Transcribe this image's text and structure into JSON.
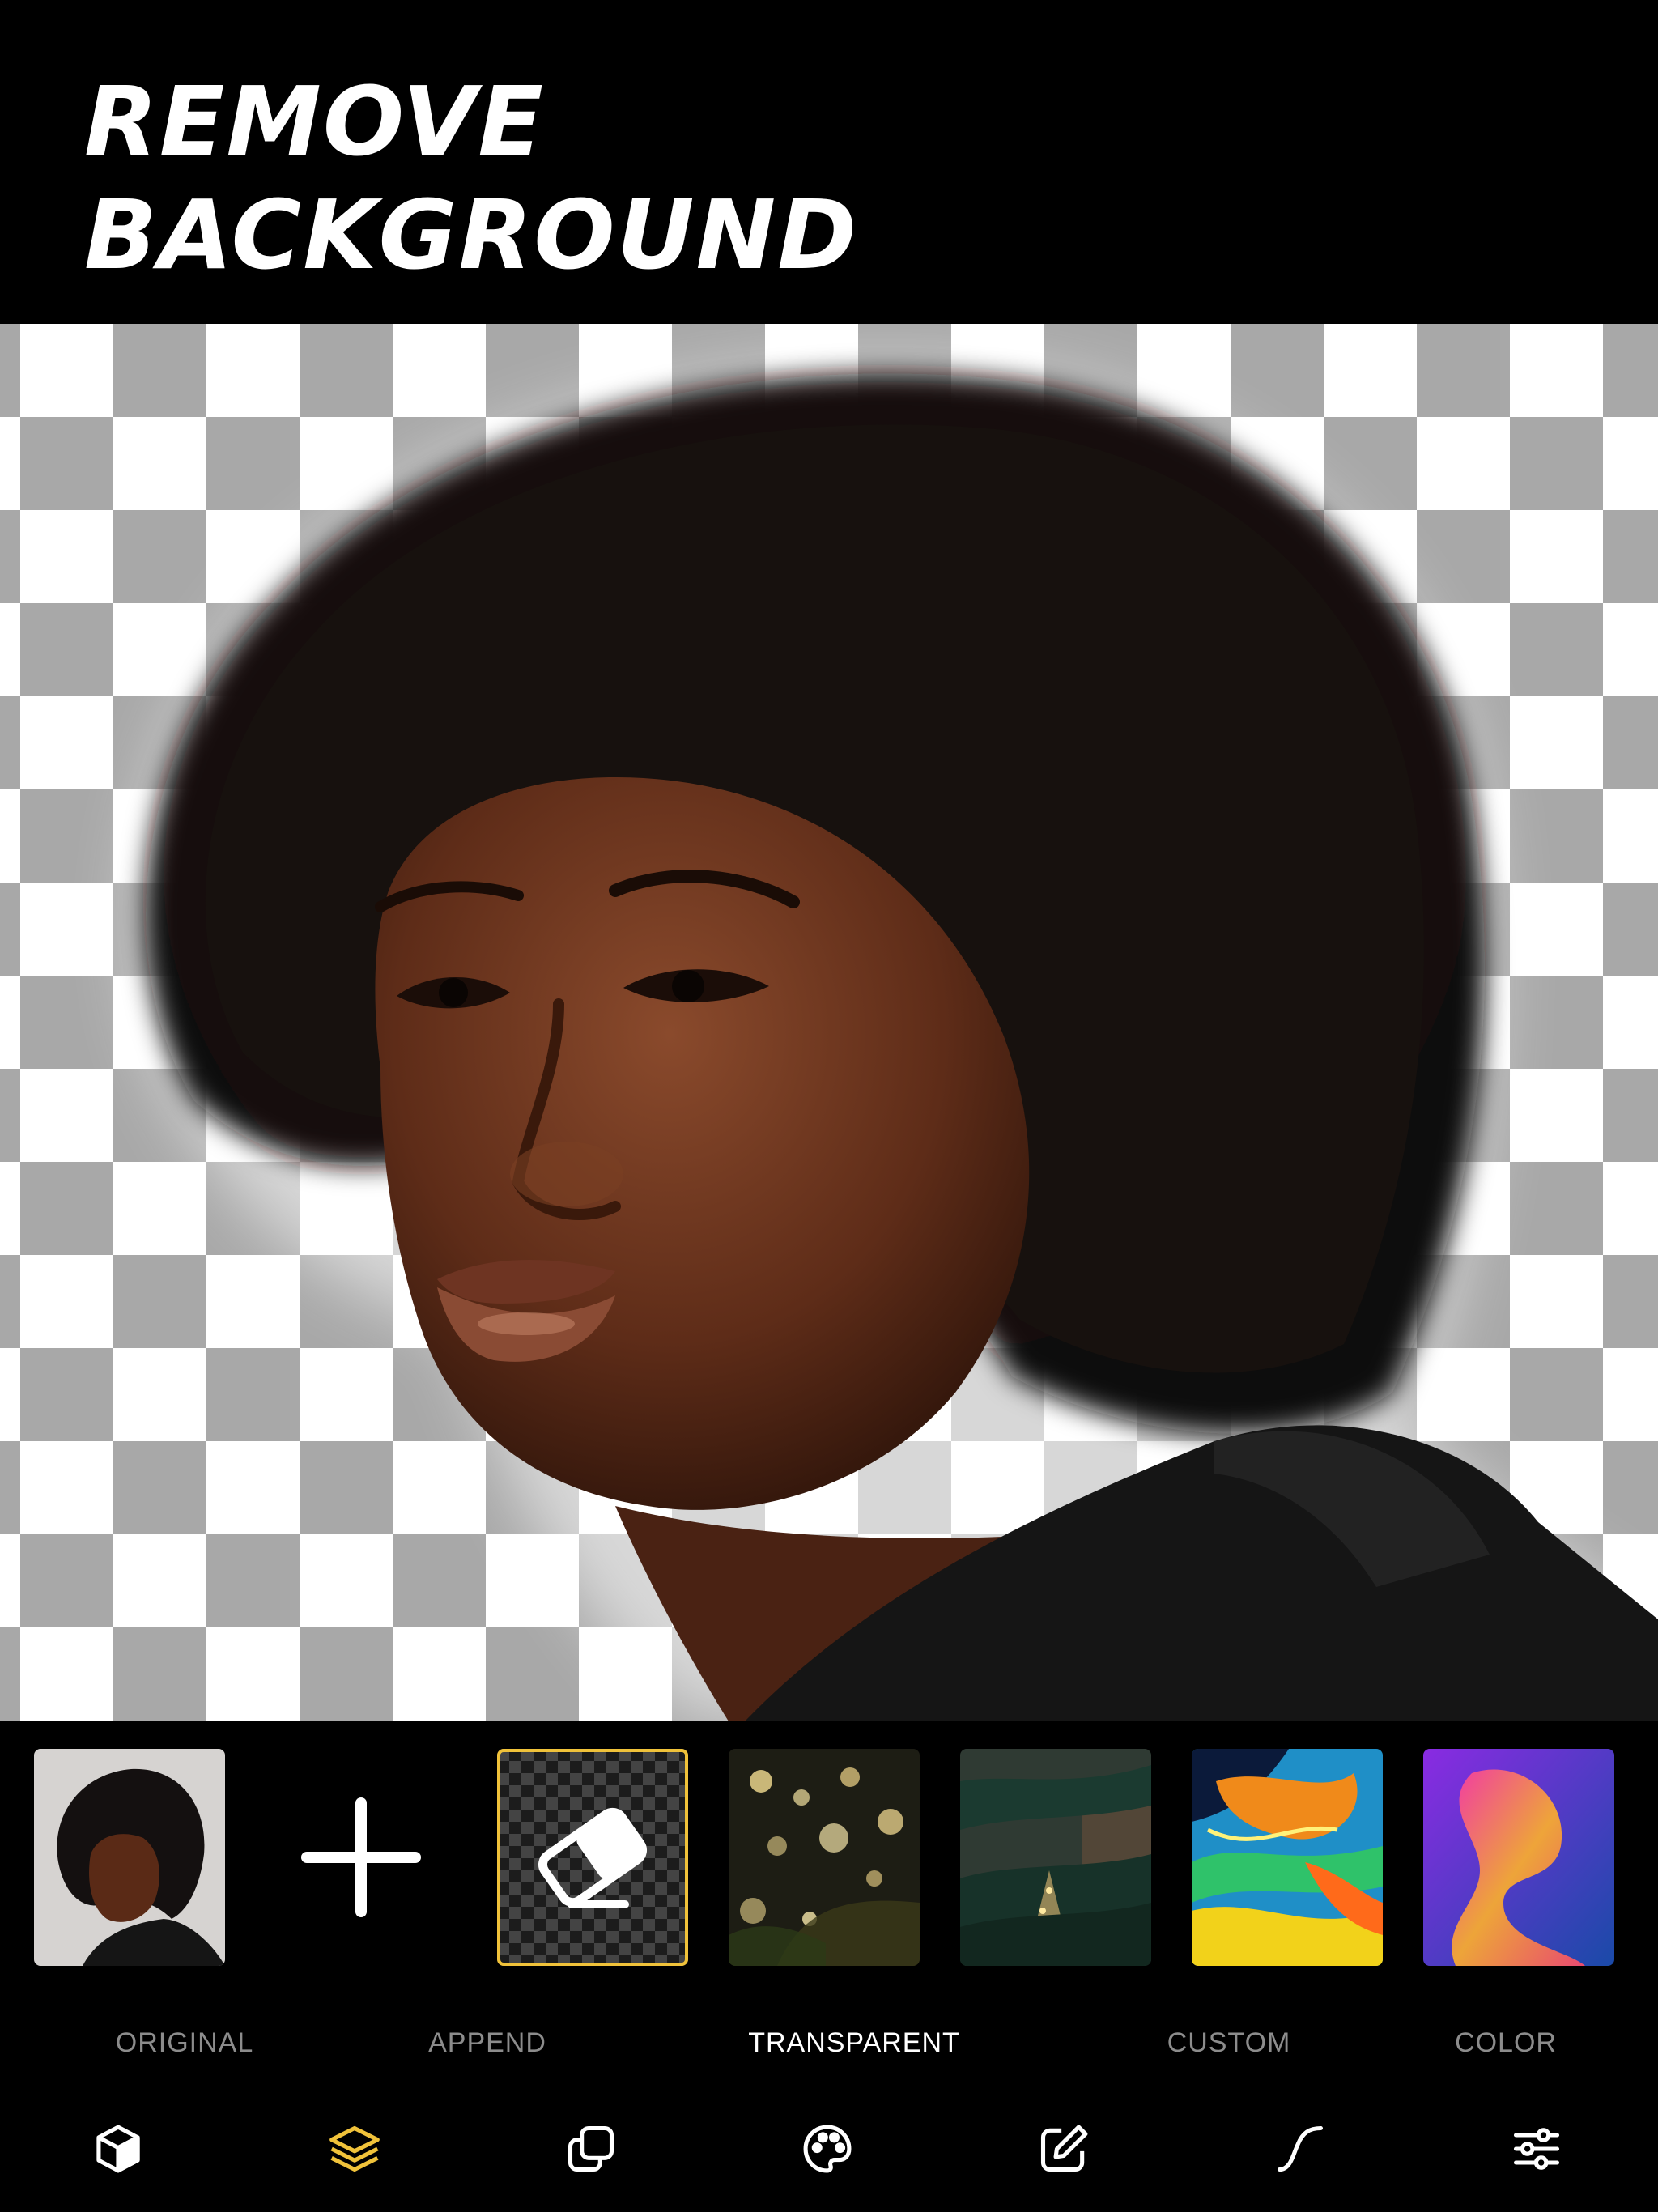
{
  "header": {
    "line1": "REMOVE",
    "line2": "BACKGROUND"
  },
  "colors": {
    "accent": "#f0c23a",
    "label_inactive": "#8c8c8c",
    "label_active": "#ffffff",
    "checker_gray": "#a8a8a8"
  },
  "thumbnails": [
    {
      "name": "original-portrait"
    },
    {
      "name": "append",
      "icon": "plus-icon"
    },
    {
      "name": "transparent",
      "icon": "eraser-icon",
      "selected": true
    },
    {
      "name": "bokeh-lights"
    },
    {
      "name": "christmas-tree"
    },
    {
      "name": "liquid-marble"
    },
    {
      "name": "gradient-blob"
    }
  ],
  "labels": {
    "original": "ORIGINAL",
    "append": "APPEND",
    "transparent": "TRANSPARENT",
    "custom": "CUSTOM",
    "color": "COLOR"
  },
  "active_label": "TRANSPARENT",
  "toolbar": [
    {
      "icon": "cube-icon"
    },
    {
      "icon": "layers-icon",
      "active": true
    },
    {
      "icon": "copy-icon"
    },
    {
      "icon": "palette-icon"
    },
    {
      "icon": "edit-icon"
    },
    {
      "icon": "curve-icon"
    },
    {
      "icon": "sliders-icon"
    }
  ]
}
